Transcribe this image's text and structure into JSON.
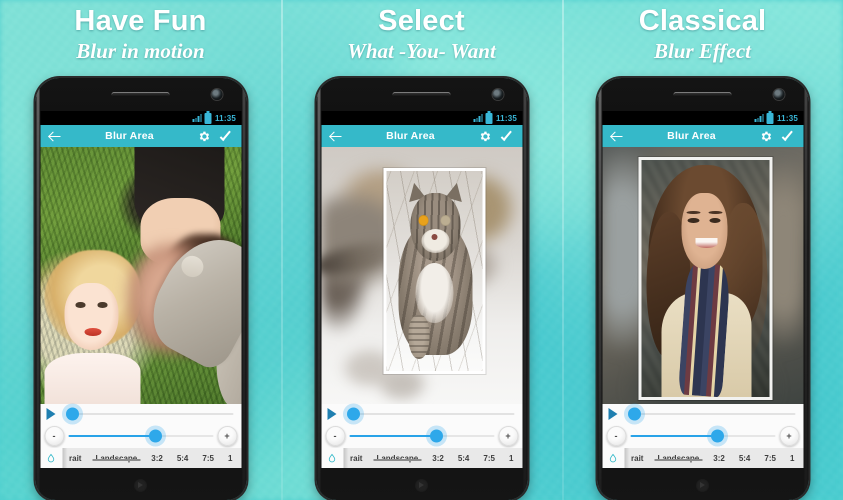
{
  "panels": [
    {
      "title": "Have Fun",
      "subtitle": "Blur in motion",
      "photo": "two-women-on-grass-one-face-blurred",
      "statusbar": {
        "time": "11:35",
        "signal_icon": "signal-bars-icon",
        "battery_icon": "battery-icon"
      },
      "appbar": {
        "back_icon": "back-arrow-icon",
        "title": "Blur Area",
        "settings_icon": "gear-icon",
        "confirm_icon": "check-icon"
      },
      "controls": {
        "play_icon": "play-triangle-icon",
        "top_slider_value": 4,
        "minus_label": "-",
        "plus_label": "+",
        "bottom_slider_value": 60,
        "droplet_icon": "water-drop-icon",
        "ratios": [
          "rait",
          "Landscape",
          "3:2",
          "5:4",
          "7:5",
          "1"
        ],
        "selected_ratio": "Landscape"
      }
    },
    {
      "title": "Select",
      "subtitle": "What -You- Want",
      "photo": "tabby-cat-in-snow-with-selection-frame",
      "statusbar": {
        "time": "11:35",
        "signal_icon": "signal-bars-icon",
        "battery_icon": "battery-icon"
      },
      "appbar": {
        "back_icon": "back-arrow-icon",
        "title": "Blur Area",
        "settings_icon": "gear-icon",
        "confirm_icon": "check-icon"
      },
      "controls": {
        "play_icon": "play-triangle-icon",
        "top_slider_value": 4,
        "minus_label": "-",
        "plus_label": "+",
        "bottom_slider_value": 60,
        "droplet_icon": "water-drop-icon",
        "ratios": [
          "rait",
          "Landscape",
          "3:2",
          "5:4",
          "7:5",
          "1"
        ],
        "selected_ratio": "Landscape"
      }
    },
    {
      "title": "Classical",
      "subtitle": "Blur Effect",
      "photo": "woman-with-plaid-scarf-with-selection-frame",
      "statusbar": {
        "time": "11:35",
        "signal_icon": "signal-bars-icon",
        "battery_icon": "battery-icon"
      },
      "appbar": {
        "back_icon": "back-arrow-icon",
        "title": "Blur Area",
        "settings_icon": "gear-icon",
        "confirm_icon": "check-icon"
      },
      "controls": {
        "play_icon": "play-triangle-icon",
        "top_slider_value": 4,
        "minus_label": "-",
        "plus_label": "+",
        "bottom_slider_value": 60,
        "droplet_icon": "water-drop-icon",
        "ratios": [
          "rait",
          "Landscape",
          "3:2",
          "5:4",
          "7:5",
          "1"
        ],
        "selected_ratio": "Landscape"
      }
    }
  ],
  "colors": {
    "background_teal": "#4fcfcf",
    "appbar_teal": "#35b9c9",
    "slider_blue": "#2ea8ea",
    "status_text_blue": "#39b7d8",
    "heading_white": "#ffffff"
  }
}
